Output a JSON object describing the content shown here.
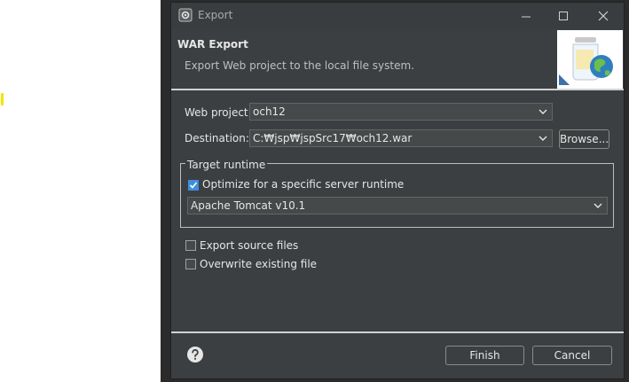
{
  "window": {
    "title": "Export",
    "icon": "eclipse-gear-icon"
  },
  "banner": {
    "title": "WAR Export",
    "description": "Export Web project to the local file system.",
    "image": "jar-globe-icon"
  },
  "form": {
    "web_project_label": "Web project:",
    "web_project_value": "och12",
    "destination_label": "Destination:",
    "destination_value": "C:₩jsp₩jspSrc17₩och12.war",
    "browse_label": "Browse..."
  },
  "target_runtime": {
    "group_label": "Target runtime",
    "optimize_label": "Optimize for a specific server runtime",
    "optimize_checked": true,
    "runtime_value": "Apache Tomcat v10.1"
  },
  "options": {
    "export_source_label": "Export source files",
    "export_source_checked": false,
    "overwrite_label": "Overwrite existing file",
    "overwrite_checked": false
  },
  "footer": {
    "help_icon": "help-icon",
    "finish_label": "Finish",
    "cancel_label": "Cancel"
  },
  "colors": {
    "dialog_bg": "#3c3f41",
    "checkbox_checked": "#3d8fdc",
    "background_marker": "#f2e600"
  }
}
